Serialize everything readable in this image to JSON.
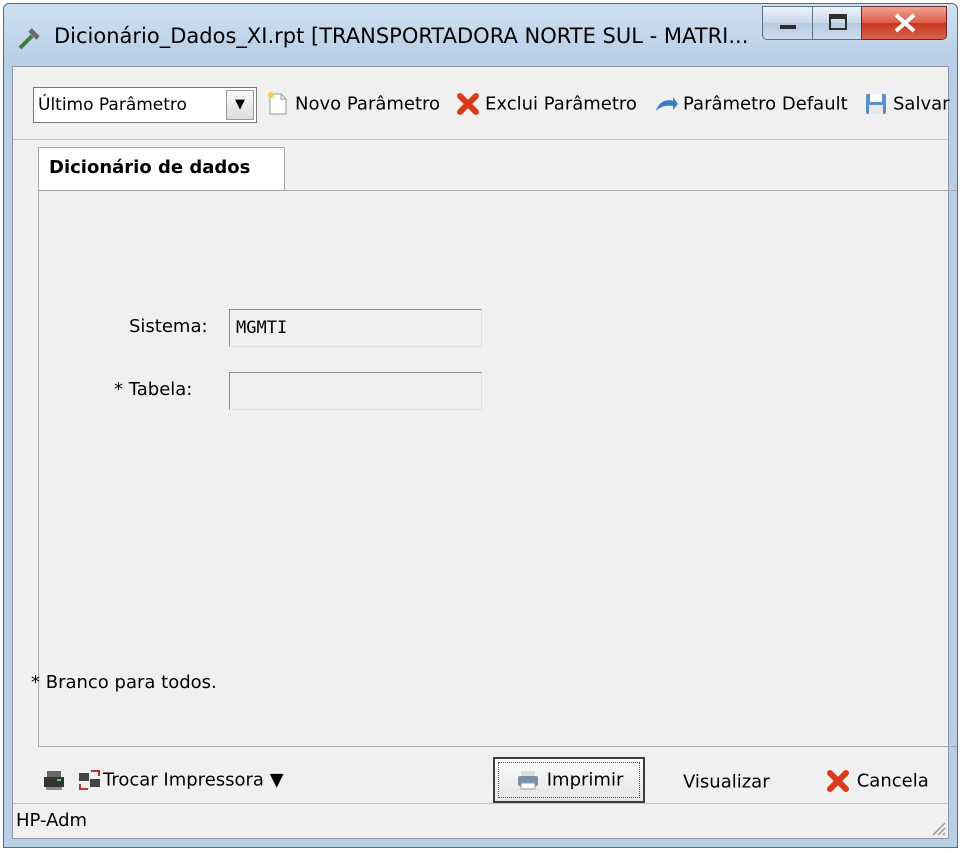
{
  "window": {
    "title": "Dicionário_Dados_XI.rpt [TRANSPORTADORA NORTE SUL -  MATRI...",
    "minimize_icon": "minimize-icon",
    "maximize_icon": "maximize-icon",
    "close_icon": "close-icon"
  },
  "toolbar": {
    "parameter_select": "Último Parâmetro",
    "new_label": "Novo Parâmetro",
    "delete_label": "Exclui Parâmetro",
    "default_label": "Parâmetro Default",
    "save_label": "Salvar"
  },
  "tabs": [
    {
      "label": "Dicionário de dados"
    }
  ],
  "form": {
    "sistema_label": "Sistema:",
    "sistema_value": "MGMTI",
    "tabela_label": "* Tabela:",
    "tabela_value": "",
    "note": "* Branco para todos."
  },
  "bottom": {
    "trocar_label": "Trocar Impressora",
    "imprimir_label": "Imprimir",
    "visualizar_label": "Visualizar",
    "cancela_label": "Cancela"
  },
  "status": {
    "text": "HP-Adm"
  },
  "colors": {
    "title_bg": "#b9cfe6",
    "close_red": "#c7371f",
    "panel": "#f0f0f0"
  }
}
